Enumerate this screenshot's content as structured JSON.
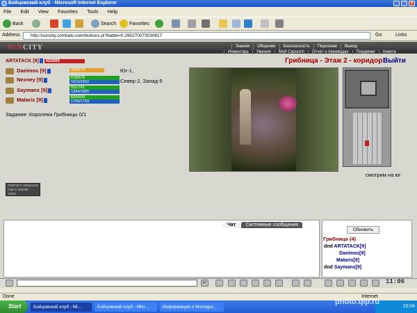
{
  "window": {
    "title": "Бойцовский клуб - Microsoft Internet Explorer"
  },
  "menu": [
    "File",
    "Edit",
    "View",
    "Favorites",
    "Tools",
    "Help"
  ],
  "toolbar": {
    "back": "Back",
    "search": "Search",
    "favorites": "Favorites"
  },
  "address": {
    "label": "Address",
    "url": "http://suncity.combats.com/buttons.pl?battle=0.295270073030817",
    "go": "Go",
    "links": "Links"
  },
  "game": {
    "logo_a": "SUN",
    "logo_b": "CITY",
    "nav_top": [
      "Знания",
      "Общение",
      "Безопасность",
      "Персонаж",
      "Выход"
    ],
    "nav_bottom": [
      "Инвентарь",
      "Умения",
      "Мой Скроллп",
      "Отчет о переводах",
      "Поединки",
      "Анкета"
    ]
  },
  "player": {
    "name": "ARTATACK",
    "level": "[9]",
    "hp": "42/2005"
  },
  "party": [
    {
      "name": "Daeimos",
      "level": "[9]",
      "hp": "329/678",
      "mp": ""
    },
    {
      "name": "Nexney",
      "level": "[9]",
      "hp": "678/678",
      "mp": "1810/1810"
    },
    {
      "name": "Saymanx",
      "level": "[9]",
      "hp": "551/741",
      "mp": "1344/1865"
    },
    {
      "name": "Mataris",
      "level": "[9]",
      "hp": "609/609",
      "mp": "1759/1759"
    }
  ],
  "location": {
    "dir1": "Юг-1,",
    "dir2": "Север-2, Запад-5",
    "title": "Грибница - Этаж 2 - коридор",
    "exit": "Выйти",
    "facing": "смотрим на юг"
  },
  "task": "Задание: Королева Грибницы 0/1",
  "counter": {
    "line1": "РЕЙТИНГ 336664604",
    "line2": "mail.ru 558089",
    "line3": "19691"
  },
  "chat": {
    "tabs": [
      "Чат",
      "Системные сообщения"
    ]
  },
  "group": {
    "refresh": "Обновить",
    "title": "Грибница (4)",
    "members": [
      {
        "prefix": "dnd",
        "name": "ARTATACK[9]"
      },
      {
        "prefix": "",
        "name": "Daeimos[9]"
      },
      {
        "prefix": "",
        "name": "Mataris[9]"
      },
      {
        "prefix": "dnd",
        "name": "Saymanx[9]"
      }
    ]
  },
  "clock": "11:06",
  "status": {
    "left": "Done",
    "right": "Internet"
  },
  "taskbar": {
    "start": "Start",
    "tasks": [
      "Бойцовский клуб - Mi...",
      "Бойцовский клуб - Micr...",
      "Информация о Mortagor..."
    ],
    "time": "15:04"
  },
  "watermark": "photo.qip.ru"
}
